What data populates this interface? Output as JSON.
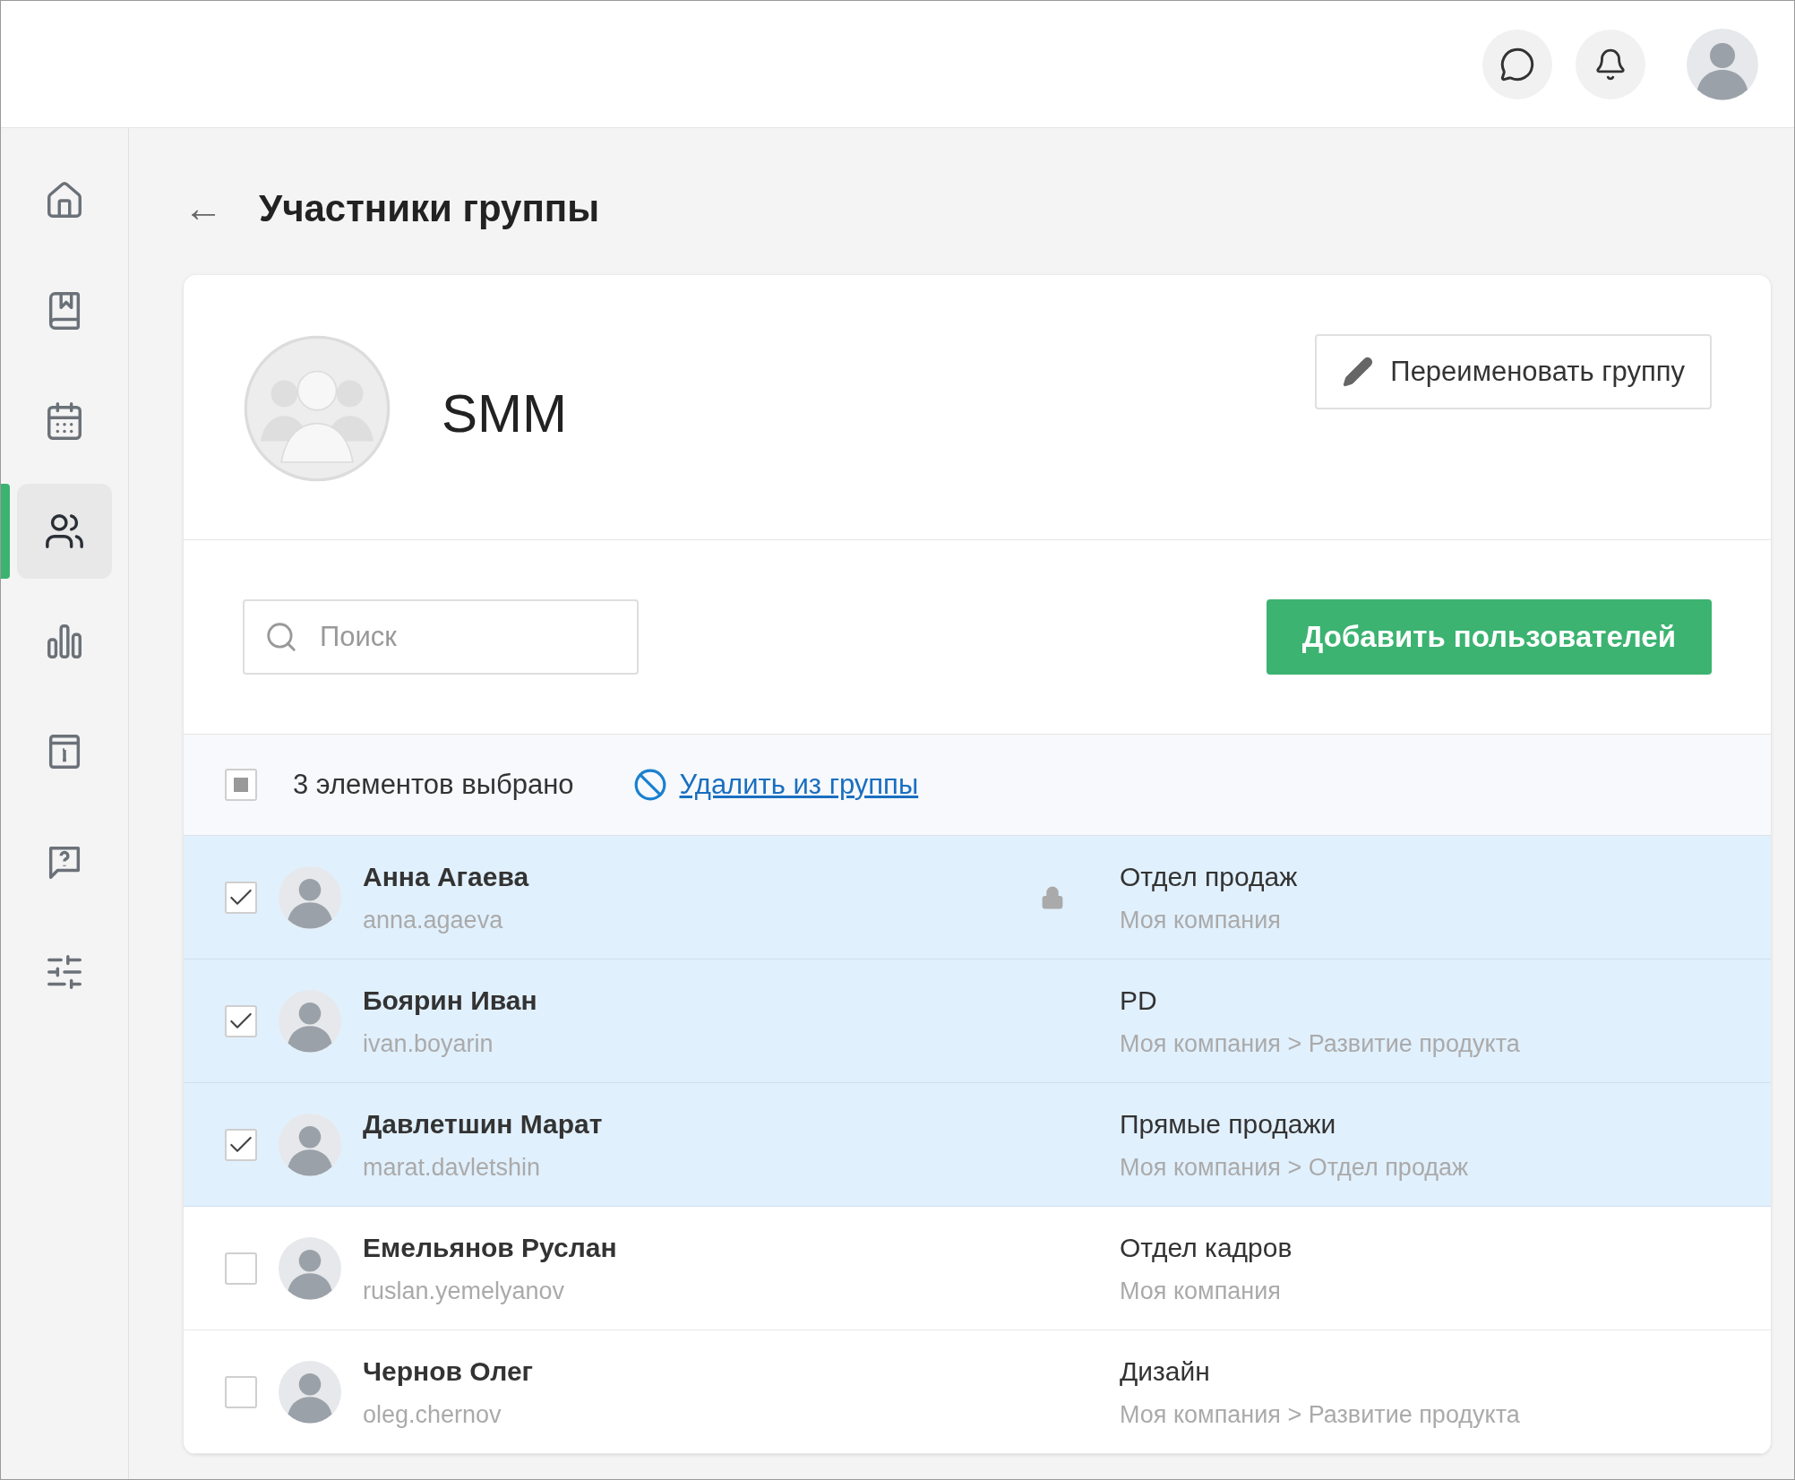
{
  "sidebar": {
    "items": [
      {
        "selected": false
      },
      {
        "selected": false
      },
      {
        "selected": false
      },
      {
        "selected": true
      },
      {
        "selected": false
      },
      {
        "selected": false
      },
      {
        "selected": false
      },
      {
        "selected": false
      }
    ]
  },
  "page": {
    "back": "←",
    "title": "Участники группы"
  },
  "group": {
    "name": "SMM",
    "rename_button": "Переименовать группу"
  },
  "search": {
    "placeholder": "Поиск"
  },
  "add_button": "Добавить пользователей",
  "selection": {
    "indeterminate": true,
    "count_text": "3 элементов выбрано",
    "remove_link": "Удалить из группы"
  },
  "members": [
    {
      "name": "Анна Агаева",
      "login": "anna.agaeva",
      "department": "Отдел продаж",
      "path": "Моя компания",
      "checked": true,
      "locked": true
    },
    {
      "name": "Боярин Иван",
      "login": "ivan.boyarin",
      "department": "PD",
      "path": "Моя компания > Развитие продукта",
      "checked": true,
      "locked": false
    },
    {
      "name": "Давлетшин Марат",
      "login": "marat.davletshin",
      "department": "Прямые продажи",
      "path": "Моя компания > Отдел продаж",
      "checked": true,
      "locked": false
    },
    {
      "name": "Емельянов Руслан",
      "login": "ruslan.yemelyanov",
      "department": "Отдел кадров",
      "path": "Моя компания",
      "checked": false,
      "locked": false
    },
    {
      "name": "Чернов Олег",
      "login": "oleg.chernov",
      "department": "Дизайн",
      "path": "Моя компания > Развитие продукта",
      "checked": false,
      "locked": false
    }
  ]
}
